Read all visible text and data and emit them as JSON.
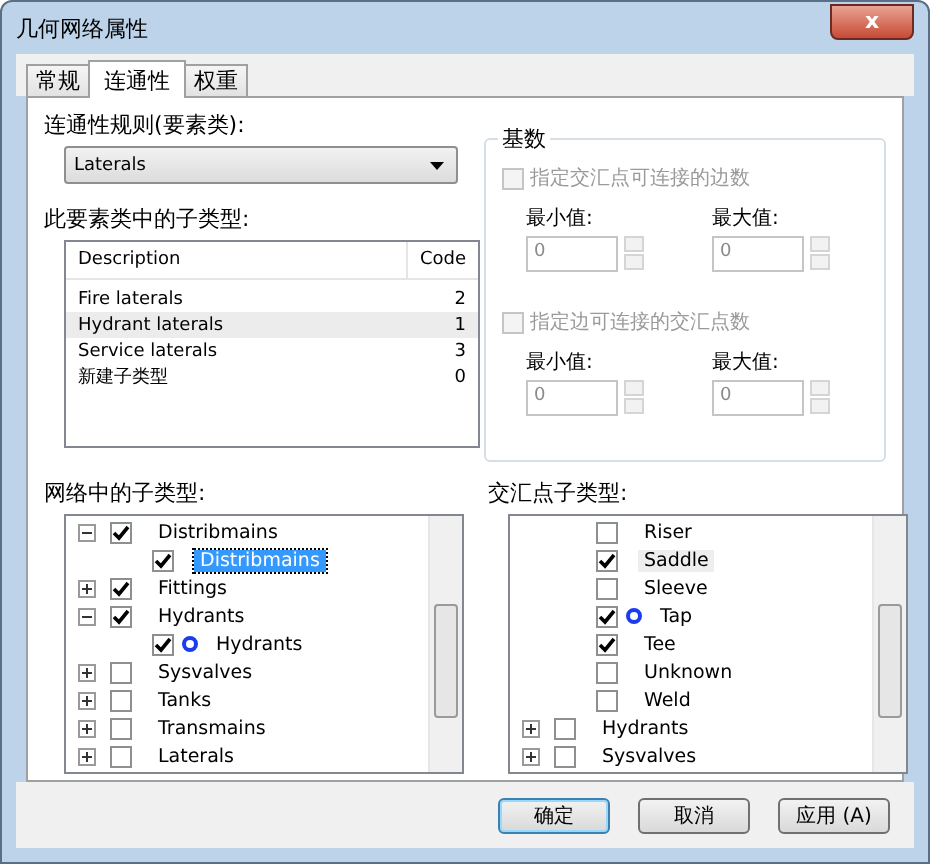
{
  "window": {
    "title": "几何网络属性",
    "close": "x"
  },
  "tabs": [
    {
      "label": "常规",
      "selected": false
    },
    {
      "label": "连通性",
      "selected": true
    },
    {
      "label": "权重",
      "selected": false
    }
  ],
  "rule": {
    "label": "连通性规则(要素类):",
    "value": "Laterals"
  },
  "subtypes": {
    "label": "此要素类中的子类型:",
    "columns": [
      "Description",
      "Code"
    ],
    "rows": [
      {
        "cells": [
          "Fire laterals",
          "2"
        ],
        "selected": false
      },
      {
        "cells": [
          "Hydrant laterals",
          "1"
        ],
        "selected": true
      },
      {
        "cells": [
          "Service laterals",
          "3"
        ],
        "selected": false
      },
      {
        "cells": [
          "新建子类型",
          "0"
        ],
        "selected": false
      }
    ]
  },
  "cardinality": {
    "title": "基数",
    "sections": [
      {
        "label": "指定交汇点可连接的边数",
        "checked": false,
        "disabled": true,
        "fields": [
          {
            "label": "最小值:",
            "value": "0"
          },
          {
            "label": "最大值:",
            "value": "0"
          }
        ]
      },
      {
        "label": "指定边可连接的交汇点数",
        "checked": false,
        "disabled": true,
        "fields": [
          {
            "label": "最小值:",
            "value": "0"
          },
          {
            "label": "最大值:",
            "value": "0"
          }
        ]
      }
    ]
  },
  "network_subtypes": {
    "label": "网络中的子类型:",
    "items": [
      {
        "label": "Distribmains",
        "checked": true,
        "expanded": true,
        "selected": false,
        "children": [
          {
            "label": "Distribmains",
            "checked": true,
            "selected": true,
            "default": false
          }
        ]
      },
      {
        "label": "Fittings",
        "checked": true,
        "expanded": false,
        "selected": false
      },
      {
        "label": "Hydrants",
        "checked": true,
        "expanded": true,
        "selected": false,
        "children": [
          {
            "label": "Hydrants",
            "checked": true,
            "selected": false,
            "default": true
          }
        ]
      },
      {
        "label": "Sysvalves",
        "checked": false,
        "expanded": false,
        "selected": false
      },
      {
        "label": "Tanks",
        "checked": false,
        "expanded": false,
        "selected": false
      },
      {
        "label": "Transmains",
        "checked": false,
        "expanded": false,
        "selected": false
      },
      {
        "label": "Laterals",
        "checked": false,
        "expanded": false,
        "selected": false
      }
    ]
  },
  "junction_subtypes": {
    "label": "交汇点子类型:",
    "items": [
      {
        "children": [
          {
            "label": "Riser",
            "checked": false,
            "highlighted": false,
            "default": false
          },
          {
            "label": "Saddle",
            "checked": true,
            "highlighted": true,
            "default": false
          },
          {
            "label": "Sleeve",
            "checked": false,
            "highlighted": false,
            "default": false
          },
          {
            "label": "Tap",
            "checked": true,
            "highlighted": false,
            "default": true
          },
          {
            "label": "Tee",
            "checked": true,
            "highlighted": false,
            "default": false
          },
          {
            "label": "Unknown",
            "checked": false,
            "highlighted": false,
            "default": false
          },
          {
            "label": "Weld",
            "checked": false,
            "highlighted": false,
            "default": false
          }
        ]
      },
      {
        "label": "Hydrants",
        "checked": false,
        "expanded": false,
        "highlighted": false
      },
      {
        "label": "Sysvalves",
        "checked": false,
        "expanded": false,
        "highlighted": false
      }
    ]
  },
  "buttons": [
    {
      "label": "确定",
      "default": true
    },
    {
      "label": "取消",
      "default": false
    },
    {
      "label": "应用 (A)",
      "default": false
    }
  ]
}
